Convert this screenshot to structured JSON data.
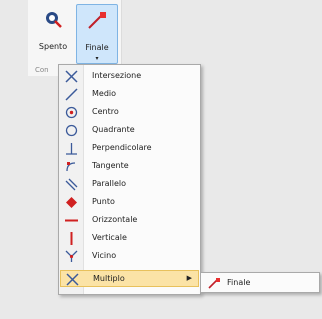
{
  "ribbon": {
    "group_label": "Con",
    "buttons": [
      {
        "label": "Spento",
        "icon": "snap-off-icon"
      },
      {
        "label": "Finale",
        "icon": "endpoint-snap-icon",
        "dropdown_caret": "▾"
      }
    ]
  },
  "menu": {
    "items": [
      {
        "label": "Intersezione",
        "icon": "intersection-icon"
      },
      {
        "label": "Medio",
        "icon": "midpoint-icon"
      },
      {
        "label": "Centro",
        "icon": "center-icon"
      },
      {
        "label": "Quadrante",
        "icon": "quadrant-icon"
      },
      {
        "label": "Perpendicolare",
        "icon": "perpendicular-icon"
      },
      {
        "label": "Tangente",
        "icon": "tangent-icon"
      },
      {
        "label": "Parallelo",
        "icon": "parallel-icon"
      },
      {
        "label": "Punto",
        "icon": "point-icon"
      },
      {
        "label": "Orizzontale",
        "icon": "horizontal-icon"
      },
      {
        "label": "Verticale",
        "icon": "vertical-icon"
      },
      {
        "label": "Vicino",
        "icon": "nearest-icon"
      },
      {
        "label": "Multiplo",
        "icon": "multiple-icon",
        "highlighted": true,
        "submenu_arrow": "▶"
      }
    ]
  },
  "submenu": {
    "items": [
      {
        "label": "Finale",
        "icon": "endpoint-snap-icon"
      }
    ]
  }
}
